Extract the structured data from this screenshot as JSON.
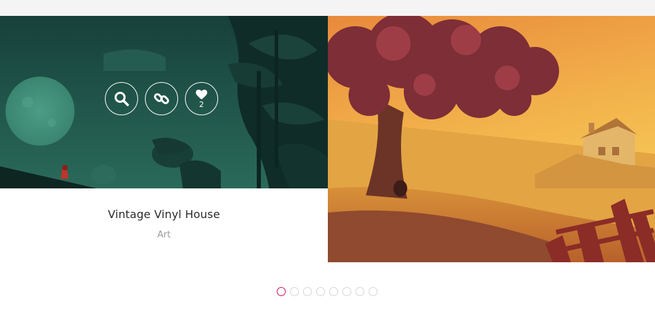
{
  "portfolio": {
    "items": [
      {
        "title": "Vintage Vinyl House",
        "category": "Art",
        "likes": "2",
        "actions": [
          "search-icon",
          "link-icon",
          "heart-icon"
        ]
      }
    ]
  },
  "pager": {
    "count": 8,
    "active_index": 0,
    "active_color": "#c8145a"
  },
  "colors": {
    "topbar": "#f4f4f4",
    "left_scene_bg": "#1e4b43",
    "right_scene_sky": "#f4b64a"
  }
}
